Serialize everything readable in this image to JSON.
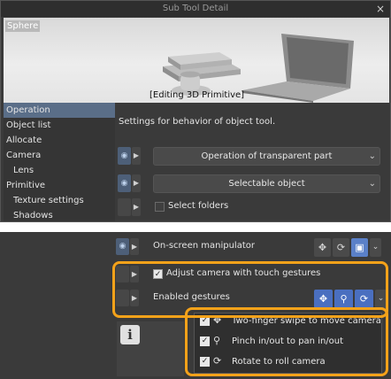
{
  "window": {
    "title": "Sub Tool Detail",
    "close_glyph": "×"
  },
  "preview": {
    "tag": "Sphere",
    "status": "[Editing 3D Primitive]"
  },
  "sidebar": {
    "items": [
      {
        "label": "Operation",
        "active": true,
        "sub": false
      },
      {
        "label": "Object list",
        "active": false,
        "sub": false
      },
      {
        "label": "Allocate",
        "active": false,
        "sub": false
      },
      {
        "label": "Camera",
        "active": false,
        "sub": false
      },
      {
        "label": "Lens",
        "active": false,
        "sub": true
      },
      {
        "label": "Primitive",
        "active": false,
        "sub": false
      },
      {
        "label": "Texture settings",
        "active": false,
        "sub": true
      },
      {
        "label": "Shadows",
        "active": false,
        "sub": true
      }
    ]
  },
  "content": {
    "description": "Settings for behavior of object tool.",
    "dropdown_transparent": "Operation of transparent part",
    "dropdown_selectable": "Selectable object",
    "select_folders": "Select folders"
  },
  "panel2": {
    "manipulator_label": "On-screen manipulator",
    "adjust_camera_label": "Adjust camera with touch gestures",
    "enabled_gestures_label": "Enabled gestures",
    "info_glyph": "i"
  },
  "gestures_popup": {
    "items": [
      {
        "label": "Two-finger swipe to move camera",
        "checked": true,
        "icon": "two-finger-swipe-icon"
      },
      {
        "label": "Pinch in/out to pan in/out",
        "checked": true,
        "icon": "pinch-icon"
      },
      {
        "label": "Rotate to roll camera",
        "checked": true,
        "icon": "rotate-icon"
      }
    ]
  },
  "colors": {
    "highlight": "#f4a21a",
    "accent": "#5a80c8",
    "panel": "#3a3a3a"
  }
}
